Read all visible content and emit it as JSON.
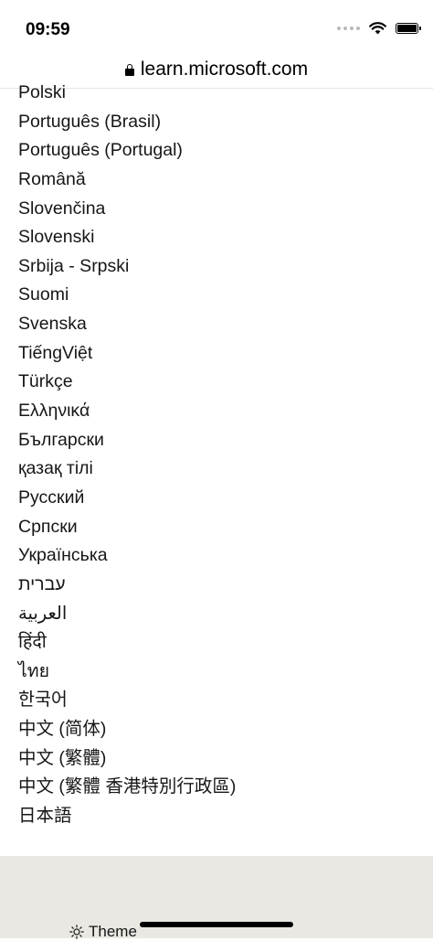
{
  "status_bar": {
    "time": "09:59"
  },
  "browser": {
    "url": "learn.microsoft.com"
  },
  "languages": [
    "Polski",
    "Português (Brasil)",
    "Português (Portugal)",
    "Română",
    "Slovenčina",
    "Slovenski",
    "Srbija - Srpski",
    "Suomi",
    "Svenska",
    "TiếngViệt",
    "Türkçe",
    "Ελληνικά",
    "Български",
    "қазақ тілі",
    "Русский",
    "Српски",
    "Українська",
    "עברית",
    "العربية",
    "हिंदी",
    "ไทย",
    "한국어",
    "中文 (简体)",
    "中文 (繁體)",
    "中文 (繁體 香港特別行政區)",
    "日本語"
  ],
  "footer": {
    "theme_label": "Theme"
  }
}
